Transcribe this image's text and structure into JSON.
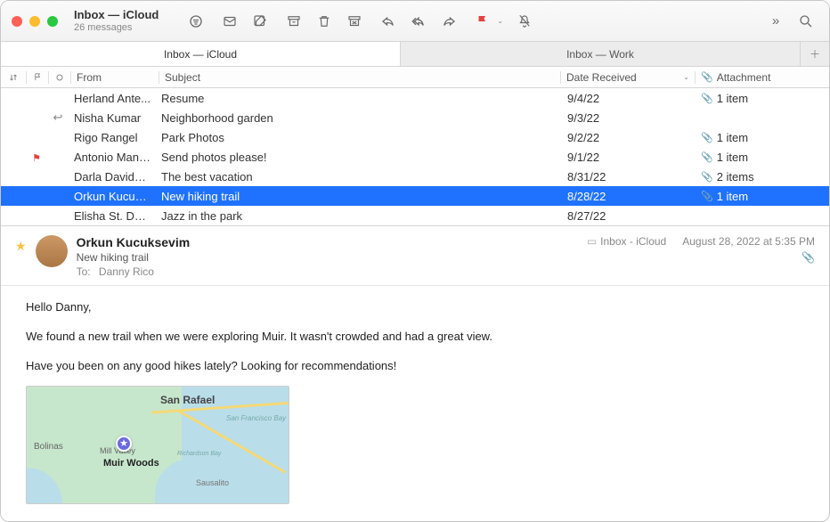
{
  "window": {
    "title": "Inbox — iCloud",
    "subtitle": "26 messages"
  },
  "tabs": {
    "items": [
      {
        "label": "Inbox — iCloud",
        "active": true
      },
      {
        "label": "Inbox — Work",
        "active": false
      }
    ]
  },
  "columns": {
    "from": "From",
    "subject": "Subject",
    "date": "Date Received",
    "attachment": "Attachment"
  },
  "messages": [
    {
      "from": "Herland Ante...",
      "subject": "Resume",
      "date": "9/4/22",
      "attachment": "1 item",
      "flagged": false,
      "replied": false,
      "selected": false
    },
    {
      "from": "Nisha Kumar",
      "subject": "Neighborhood garden",
      "date": "9/3/22",
      "attachment": "",
      "flagged": false,
      "replied": true,
      "selected": false
    },
    {
      "from": "Rigo Rangel",
      "subject": "Park Photos",
      "date": "9/2/22",
      "attachment": "1 item",
      "flagged": false,
      "replied": false,
      "selected": false
    },
    {
      "from": "Antonio Manri...",
      "subject": "Send photos please!",
      "date": "9/1/22",
      "attachment": "1 item",
      "flagged": true,
      "replied": false,
      "selected": false
    },
    {
      "from": "Darla Davidson",
      "subject": "The best vacation",
      "date": "8/31/22",
      "attachment": "2 items",
      "flagged": false,
      "replied": false,
      "selected": false
    },
    {
      "from": "Orkun Kucuks...",
      "subject": "New hiking trail",
      "date": "8/28/22",
      "attachment": "1 item",
      "flagged": false,
      "replied": false,
      "selected": true
    },
    {
      "from": "Elisha St. Denis",
      "subject": "Jazz in the park",
      "date": "8/27/22",
      "attachment": "",
      "flagged": false,
      "replied": false,
      "selected": false
    }
  ],
  "preview": {
    "sender": "Orkun Kucuksevim",
    "subject": "New hiking trail",
    "to_label": "To:",
    "to_name": "Danny Rico",
    "folder": "Inbox - iCloud",
    "datetime": "August 28, 2022 at 5:35 PM",
    "body": {
      "p1": "Hello Danny,",
      "p2": "We found a new trail when we were exploring Muir. It wasn't crowded and had a great view.",
      "p3": "Have you been on any good hikes lately? Looking for recommendations!"
    },
    "map": {
      "pin_label": "Muir Woods",
      "labels": {
        "san_rafael": "San Rafael",
        "bolinas": "Bolinas",
        "mill_valley": "Mill Valley",
        "sausalito": "Sausalito",
        "san_francisco_bay": "San Francisco Bay",
        "richardson_bay": "Richardson Bay"
      }
    }
  }
}
